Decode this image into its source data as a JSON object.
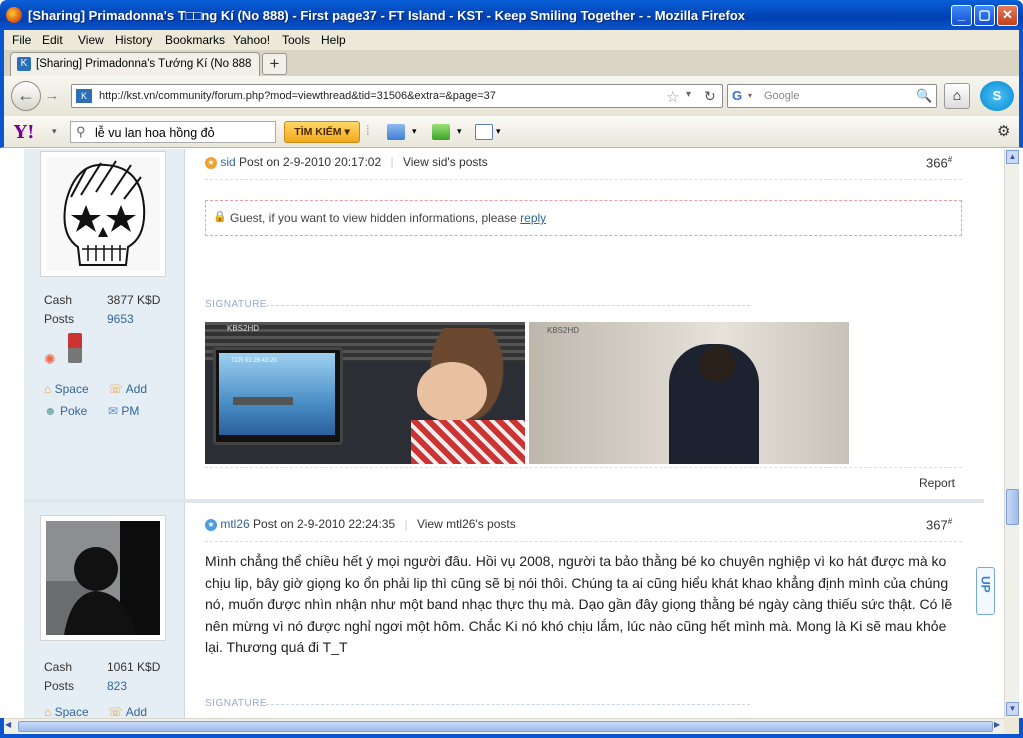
{
  "window": {
    "title": "[Sharing] Primadonna's T□□ng Kí (No 888) - First page37 - FT Island - KST - Keep Smiling Together - - Mozilla Firefox"
  },
  "menu": [
    "File",
    "Edit",
    "View",
    "History",
    "Bookmarks",
    "Yahoo!",
    "Tools",
    "Help"
  ],
  "tab": {
    "title": "[Sharing] Primadonna's Tướng Kí (No 888) - ...",
    "new_tab": "+"
  },
  "nav": {
    "url": "http://kst.vn/community/forum.php?mod=viewthread&tid=31506&extra=&page=37",
    "search_placeholder": "Google",
    "search_engine": "G"
  },
  "yahoo": {
    "logo": "Y!",
    "search_value": "lễ vu lan hoa hồng đỏ",
    "search_button": "TÌM KIẾM ▾"
  },
  "posts": [
    {
      "author": "sid",
      "meta": "Post on 2-9-2010 20:17:02",
      "view_link": "View sid's posts",
      "number": "366",
      "number_sup": "#",
      "cash_label": "Cash",
      "cash_value": "3877 K$D",
      "posts_label": "Posts",
      "posts_value": "9653",
      "actions": {
        "space": "Space",
        "add": "Add",
        "poke": "Poke",
        "pm": "PM"
      },
      "hidden_text": "Guest, if you want to view hidden informations, please ",
      "hidden_link": "reply",
      "signature_label": "SIGNATURE",
      "report": "Report"
    },
    {
      "author": "mtl26",
      "meta": "Post on 2-9-2010 22:24:35",
      "view_link": "View mtl26's posts",
      "number": "367",
      "number_sup": "#",
      "cash_label": "Cash",
      "cash_value": "1061 K$D",
      "posts_label": "Posts",
      "posts_value": "823",
      "actions": {
        "space": "Space",
        "add": "Add"
      },
      "content": "Mình chẳng thể chiều hết ý mọi người đâu. Hồi vụ 2008, người ta bảo thằng bé ko chuyên nghiệp vì ko hát được mà ko chịu lip, bây giờ giọng ko ổn phải lip thì cũng sẽ bị nói thôi. Chúng ta ai cũng hiểu khát khao khẳng định mình của chúng nó, muốn được nhìn nhận như một band nhạc thực thụ mà. Dạo gần đây giọng thằng bé ngày càng thiếu sức thật. Có lẽ nên mừng vì nó được nghỉ ngơi một hôm. Chắc Ki nó khó chịu lắm, lúc nào cũng hết mình mà. Mong là Ki sẽ mau khỏe lại. Thương quá đi T_T",
      "signature_label": "SIGNATURE"
    }
  ],
  "sig_images": [
    {
      "badge": "KBS2HD",
      "clock": "TCR 01:26:43:20"
    },
    {
      "badge": "KBS2HD"
    }
  ],
  "up_button": "UP",
  "colors": {
    "titlebar": "#0b55cf",
    "link": "#336699",
    "sidebar": "#e6eef5"
  }
}
